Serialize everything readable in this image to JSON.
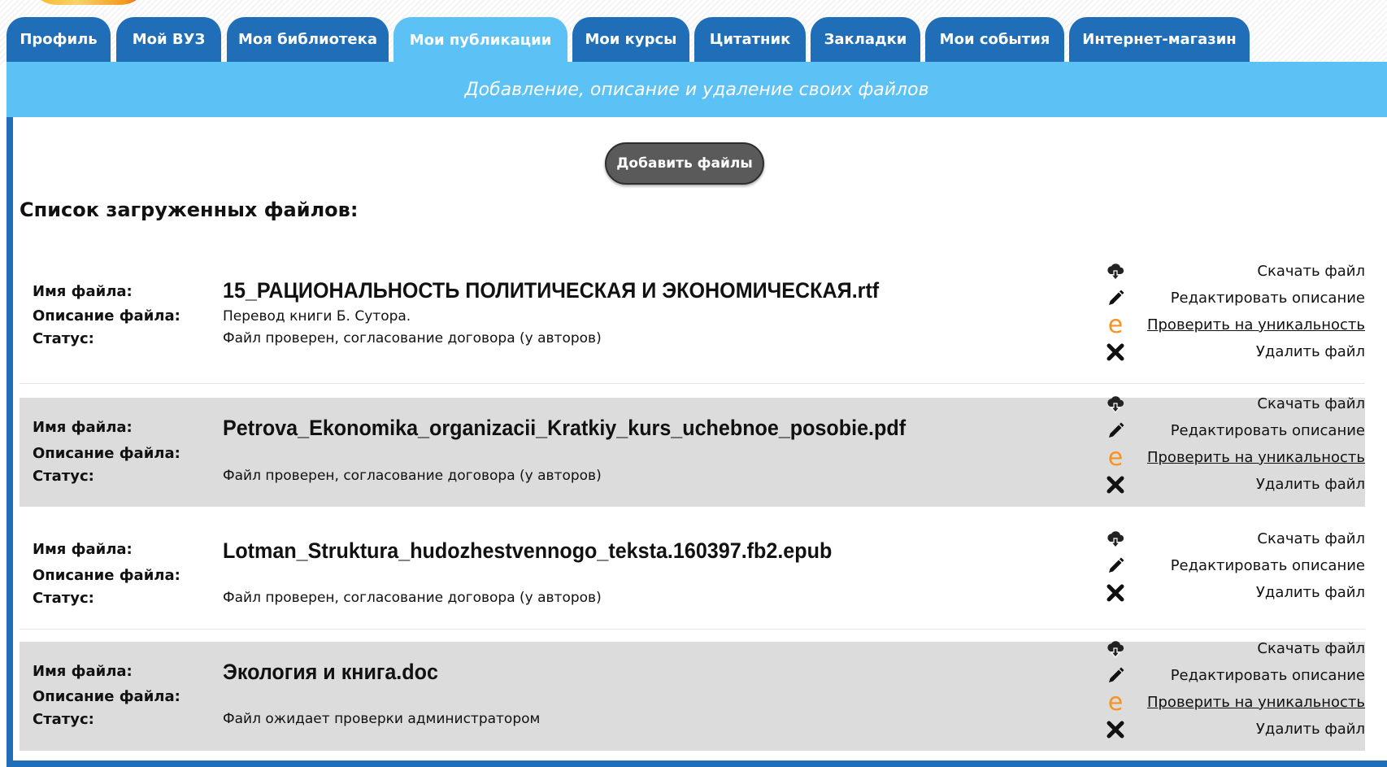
{
  "tabs": [
    {
      "label": "Профиль",
      "active": false
    },
    {
      "label": "Мой ВУЗ",
      "active": false
    },
    {
      "label": "Моя библиотека",
      "active": false
    },
    {
      "label": "Мои публикации",
      "active": true
    },
    {
      "label": "Мои курсы",
      "active": false
    },
    {
      "label": "Цитатник",
      "active": false
    },
    {
      "label": "Закладки",
      "active": false
    },
    {
      "label": "Мои события",
      "active": false
    },
    {
      "label": "Интернет-магазин",
      "active": false
    }
  ],
  "banner": "Добавление, описание и удаление своих файлов",
  "add_button": "Добавить файлы",
  "list_title": "Список загруженных файлов:",
  "labels": {
    "name": "Имя файла:",
    "description": "Описание файла:",
    "status": "Статус:"
  },
  "actions": {
    "download": "Скачать файл",
    "edit": "Редактировать описание",
    "check": "Проверить на уникальность",
    "delete": "Удалить файл"
  },
  "files": [
    {
      "name": "15_РАЦИОНАЛЬНОСТЬ ПОЛИТИЧЕСКАЯ И ЭКОНОМИЧЕСКАЯ.rtf",
      "description": " Перевод книги Б. Сутора.",
      "status": "Файл проверен, согласование договора (у авторов)",
      "has_check": true
    },
    {
      "name": "Petrova_Ekonomika_organizacii_Kratkiy_kurs_uchebnoe_posobie.pdf",
      "description": "",
      "status": "Файл проверен, согласование договора (у авторов)",
      "has_check": true
    },
    {
      "name": "Lotman_Struktura_hudozhestvennogo_teksta.160397.fb2.epub",
      "description": "",
      "status": "Файл проверен, согласование договора (у авторов)",
      "has_check": false
    },
    {
      "name": "Экология и книга.doc",
      "description": "",
      "status": "Файл ожидает проверки администратором",
      "has_check": true
    }
  ],
  "colors": {
    "tab": "#1f6eb7",
    "active_tab": "#5cc1f5",
    "banner": "#5cc1f5",
    "check_icon": "#f7931e"
  },
  "icons": {
    "download": "cloud-download-icon",
    "edit": "pencil-icon",
    "check": "antiplagiarism-e-icon",
    "delete": "close-x-icon"
  }
}
